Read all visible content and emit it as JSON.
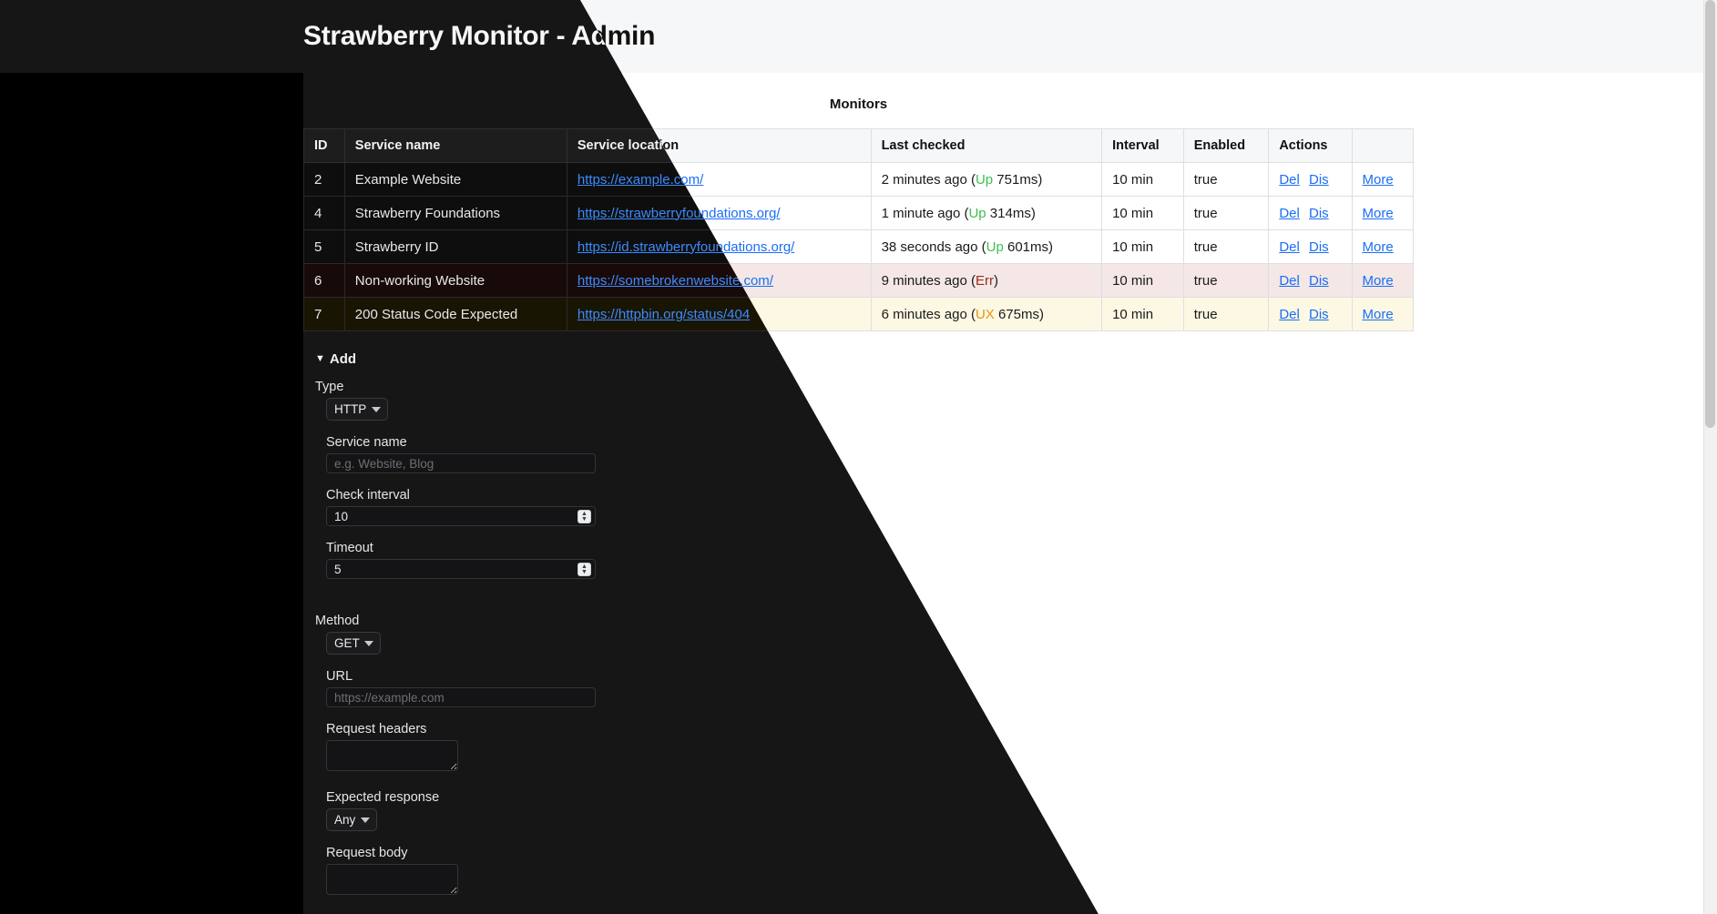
{
  "header": {
    "title": "Strawberry Monitor - Admin"
  },
  "main": {
    "section_title": "Monitors",
    "table": {
      "columns": [
        "ID",
        "Service name",
        "Service location",
        "Last checked",
        "Interval",
        "Enabled",
        "Actions",
        ""
      ],
      "rows": [
        {
          "id": "2",
          "name": "Example Website",
          "location": "https://example.com/",
          "checked_prefix": "2 minutes ago (",
          "status": "Up",
          "status_kind": "up",
          "checked_suffix": " 751ms)",
          "interval": "10 min",
          "enabled": "true",
          "del": "Del",
          "dis": "Dis",
          "more": "More",
          "state": "ok"
        },
        {
          "id": "4",
          "name": "Strawberry Foundations",
          "location": "https://strawberryfoundations.org/",
          "checked_prefix": "1 minute ago (",
          "status": "Up",
          "status_kind": "up",
          "checked_suffix": " 314ms)",
          "interval": "10 min",
          "enabled": "true",
          "del": "Del",
          "dis": "Dis",
          "more": "More",
          "state": "ok"
        },
        {
          "id": "5",
          "name": "Strawberry ID",
          "location": "https://id.strawberryfoundations.org/",
          "checked_prefix": "38 seconds ago (",
          "status": "Up",
          "status_kind": "up",
          "checked_suffix": " 601ms)",
          "interval": "10 min",
          "enabled": "true",
          "del": "Del",
          "dis": "Dis",
          "more": "More",
          "state": "ok"
        },
        {
          "id": "6",
          "name": "Non-working Website",
          "location": "https://somebrokenwebsite.com/",
          "checked_prefix": "9 minutes ago (",
          "status": "Err",
          "status_kind": "err",
          "checked_suffix": ")",
          "interval": "10 min",
          "enabled": "true",
          "del": "Del",
          "dis": "Dis",
          "more": "More",
          "state": "err"
        },
        {
          "id": "7",
          "name": "200 Status Code Expected",
          "location": "https://httpbin.org/status/404",
          "checked_prefix": "6 minutes ago (",
          "status": "UX",
          "status_kind": "ux",
          "checked_suffix": " 675ms)",
          "interval": "10 min",
          "enabled": "true",
          "del": "Del",
          "dis": "Dis",
          "more": "More",
          "state": "warn"
        }
      ]
    }
  },
  "form": {
    "heading": "Add",
    "caret": "▼",
    "type_label": "Type",
    "type_value": "HTTP",
    "service_name_label": "Service name",
    "service_name_placeholder": "e.g. Website, Blog",
    "service_name_value": "",
    "check_interval_label": "Check interval",
    "check_interval_value": "10",
    "timeout_label": "Timeout",
    "timeout_value": "5",
    "method_label": "Method",
    "method_value": "GET",
    "url_label": "URL",
    "url_placeholder": "https://example.com",
    "url_value": "",
    "request_headers_label": "Request headers",
    "request_headers_value": "",
    "expected_response_label": "Expected response",
    "expected_response_value": "Any",
    "request_body_label": "Request body",
    "request_body_value": ""
  },
  "colors": {
    "accent_link": "#1a6ef5",
    "up": "#3fbf50",
    "error": "#9c2c20",
    "warn": "#e8940f",
    "dark_surface": "#161616",
    "light_surface": "#ffffff"
  }
}
